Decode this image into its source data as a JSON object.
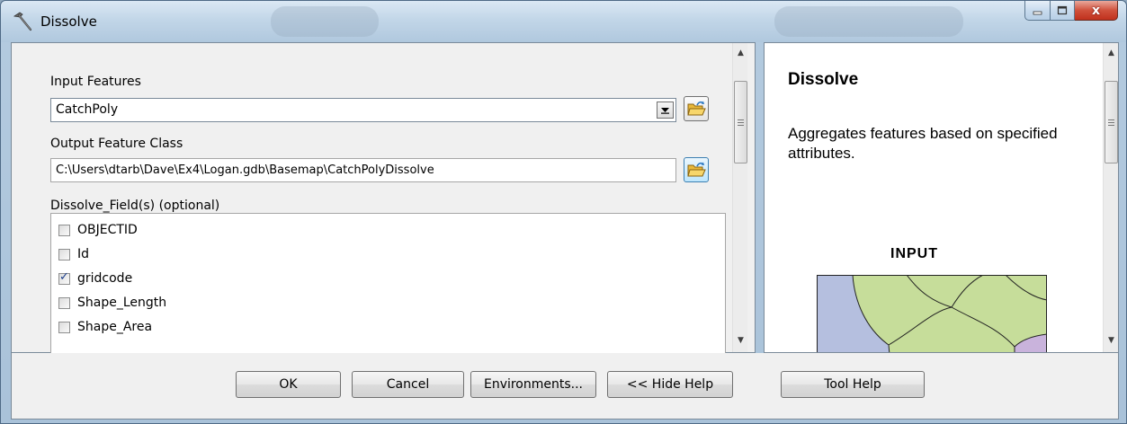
{
  "window": {
    "title": "Dissolve",
    "title_icon": "hammer-icon",
    "caption_icons": [
      "minimize-icon",
      "maximize-icon",
      "close-icon"
    ],
    "close_glyph": "x"
  },
  "form": {
    "input_features_label": "Input Features",
    "input_features_value": "CatchPoly",
    "output_label": "Output Feature Class",
    "output_value": "C:\\Users\\dtarb\\Dave\\Ex4\\Logan.gdb\\Basemap\\CatchPolyDissolve",
    "dissolve_label": "Dissolve_Field(s) (optional)",
    "fields": [
      {
        "name": "OBJECTID",
        "checked": false
      },
      {
        "name": "Id",
        "checked": false
      },
      {
        "name": "gridcode",
        "checked": true
      },
      {
        "name": "Shape_Length",
        "checked": false
      },
      {
        "name": "Shape_Area",
        "checked": false
      }
    ]
  },
  "help": {
    "title": "Dissolve",
    "description": "Aggregates features based on specified attributes.",
    "illustration_label": "INPUT"
  },
  "buttons": {
    "ok": "OK",
    "cancel": "Cancel",
    "environments": "Environments...",
    "hide_help": "<< Hide Help",
    "tool_help": "Tool Help"
  },
  "colors": {
    "illus_blue": "#b5bfdf",
    "illus_green": "#c6dd9a",
    "illus_purple": "#c9b3dc"
  }
}
